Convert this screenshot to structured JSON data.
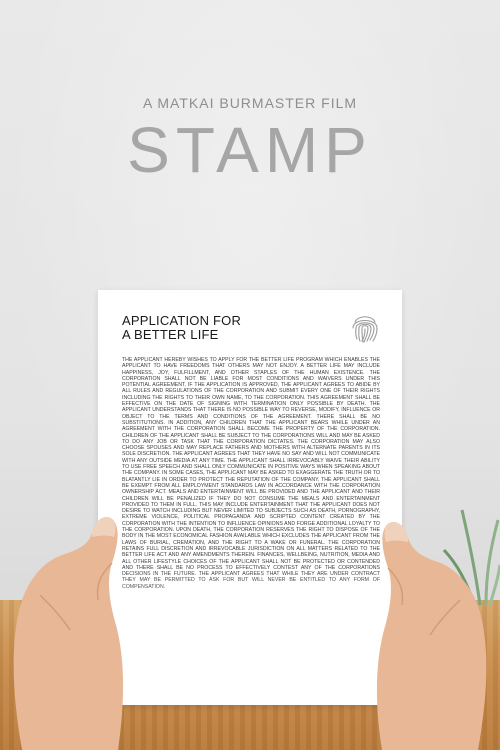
{
  "poster": {
    "tagline": "A MATKAI BURMASTER FILM",
    "title": "STAMP"
  },
  "document": {
    "title_line1": "APPLICATION FOR",
    "title_line2": "A BETTER LIFE",
    "body": "THE APPLICANT HEREBY WISHES TO APPLY FOR THE BETTER LIFE PROGRAM WHICH ENABLES THE APPLICANT TO HAVE FREEDOMS THAT OTHERS MAY NOT ENJOY. A BETTER LIFE MAY INCLUDE HAPPINESS, JOY, FULFILLMENT, AND OTHER STAPLES OF THE HUMAN EXISTENCE. THE CORPORATION SHALL NOT BE LIABLE FOR MOST CONDITIONS AND WAIVERS UNDER THIS POTENTIAL AGREEMENT. IF THE APPLICATION IS APPROVED, THE APPLICANT AGREES TO ABIDE BY ALL RULES AND REGULATIONS OF THE CORPORATION AND SUBMIT EVERY ONE OF THEIR RIGHTS INCLUDING THE RIGHTS TO THEIR OWN NAME, TO THE CORPORATION. THIS AGREEMENT SHALL BE EFFECTIVE ON THE DATE OF SIGNING WITH TERMINATION ONLY POSSIBLE BY DEATH. THE APPLICANT UNDERSTANDS THAT THERE IS NO POSSIBLE WAY TO REVERSE, MODIFY, INFLUENCE OR OBJECT TO THE TERMS AND CONDITIONS OF THE AGREEMENT. THERE SHALL BE NO SUBSTITUTIONS. IN ADDITION, ANY CHILDREN THAT THE APPLICANT BEARS WHILE UNDER AN AGREEMENT WITH THE CORPORATION SHALL BECOME THE PROPERTY OF THE CORPORATION. CHILDREN OF THE APPLICANT SHALL BE SUBJECT TO THE CORPORATIONS WILL AND MAY BE ASKED TO DO ANY JOB OR TASK THAT THE CORPORATION DICTATES. THE CORPORATION MAY ALSO CHOOSE SPOUSES AND MAY REPLACE FATHERS AND MOTHERS WITH ALTERNATE PARENTS IN ITS SOLE DISCRETION. THE APPLICANT AGREES THAT THEY HAVE NO SAY AND WILL NOT COMMUNICATE WITH ANY OUTSIDE MEDIA AT ANY TIME. THE APPLICANT SHALL IRREVOCABLY WAIVE THEIR ABILITY TO USE FREE SPEECH AND SHALL ONLY COMMUNICATE IN POSITIVE WAYS WHEN SPEAKING ABOUT THE COMPANY. IN SOME CASES, THE APPLICANT MAY BE ASKED TO EXAGGERATE THE TRUTH OR TO BLATANTLY LIE IN ORDER TO PROTECT THE REPUTATION OF THE COMPANY. THE APPLICANT SHALL BE EXEMPT FROM ALL EMPLOYMENT STANDARDS LAW IN ACCORDANCE WITH THE CORPORATION OWNERSHIP ACT. MEALS AND ENTERTAINMENT WILL BE PROVIDED AND THE APPLICANT AND THEIR CHILDREN WILL BE PENALIZED IF THEY DO NOT CONSUME THE MEALS AND ENTERTAINMENT PROVIDED TO THEM IN FULL. THIS MAY INCLUDE ENTERTAINMENT THAT THE APPLICANT DOES NOT DESIRE TO WATCH INCLUDING BUT NEVER LIMITED TO SUBJECTS SUCH AS DEATH, PORNOGRAPHY, EXTREME VIOLENCE, POLITICAL PROPAGANDA AND SCRIPTED CONTENT CREATED BY THE CORPORATION WITH THE INTENTION TO INFLUENCE OPINIONS AND FORGE ADDITIONAL LOYALTY TO THE CORPORATION. UPON DEATH, THE CORPORATION RESERVES THE RIGHT TO DISPOSE OF THE BODY IN THE MOST ECONOMICAL FASHION AVAILABLE WHICH EXCLUDES THE APPLICANT FROM THE LAWS OF BURIAL, CREMATION, AND THE RIGHT TO A WAKE OR FUNERAL. THE CORPORATION RETAINS FULL DISCRETION AND IRREVOCABLE JURISDICTION ON ALL MATTERS RELATED TO THE BETTER LIFE ACT AND ANY AMENDMENTS THEREIN. FINANCES, WELLBEING, NUTRITION, MEDIA AND ALL OTHER LIFESTYLE CHOICES OF THE APPLICANT SHALL NOT BE PROTECTED OR CONTENDED AND THERE SHALL BE NO PROCESS TO EFFECTIVELY CONTEST ANY OF THE CORPORATIONS DECISIONS IN THE FUTURE. THE APPLICANT AGREES THAT WHILE THEY ARE UNDER CONTRACT THEY MAY BE PERMITTED TO ASK FOR BUT WILL NEVER BE ENTITLED TO ANY FORM OF COMPENSATION."
  },
  "colors": {
    "wall": "#e6e6e6",
    "title_gray": "#a6a6a6",
    "tagline_gray": "#8e8e8e",
    "paper": "#ffffff",
    "table_wood": "#c98e4e",
    "skin": "#e8b896"
  },
  "icons": {
    "fingerprint": "fingerprint-icon"
  }
}
